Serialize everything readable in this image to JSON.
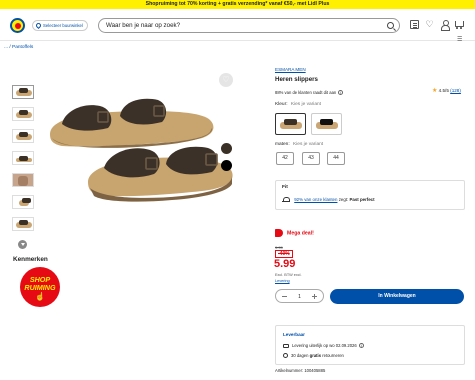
{
  "promo": {
    "text": "Shopruiming tot 70% korting + gratis verzending* vanaf €50,- met Lidl Plus"
  },
  "header": {
    "store_label": "Selecteer buurwinkel",
    "search_value": "Waar ben je naar op zoek?",
    "icons": [
      "list-icon",
      "heart-icon",
      "user-icon",
      "cart-icon",
      "menu-icon"
    ]
  },
  "breadcrumb": {
    "text": "... / Pantoffels"
  },
  "gallery": {
    "thumb_count": 7,
    "main_image": "brown-slide-sandals-pair"
  },
  "features": {
    "heading": "Kenmerken",
    "badge_line1": "SHOP",
    "badge_line2": "RUIMING"
  },
  "product": {
    "brand": "ESMARA MEN",
    "title": "Heren slippers",
    "recommend": "88% van de klanten raadt dit aan",
    "rating_value": "4.5/5",
    "rating_count": "(128)",
    "rating_stars": 4.5
  },
  "color": {
    "label": "Kleur:",
    "sub": "Kies je variant",
    "options": [
      "brown",
      "black"
    ]
  },
  "size": {
    "label": "maten:",
    "sub": "Kies je variant",
    "options": [
      "42",
      "43",
      "44"
    ]
  },
  "fit": {
    "title": "Fit",
    "link": "92% van onze klanten",
    "suffix_pre": "zegt:",
    "suffix_bold": "Past perfect"
  },
  "pricing": {
    "deal": "Mega deal!",
    "old_price": "9.99",
    "discount": "-40%",
    "price": "5.99",
    "vat": "Excl. BTW excl.",
    "delivery_link": "Levering"
  },
  "cart": {
    "quantity": "1",
    "button": "In Winkelwagen"
  },
  "shipping": {
    "title": "Leverbaar",
    "line1": "Levering uiterlijk op wo 02.09.2026",
    "line2_pre": "30 dagen",
    "line2_bold": "gratis",
    "line2_post": "retourneren"
  },
  "article": {
    "text": "Artikelnummer: 100405885"
  },
  "colors": {
    "lidl_blue": "#0050aa",
    "lidl_yellow": "#fff000",
    "lidl_red": "#e60a14"
  }
}
